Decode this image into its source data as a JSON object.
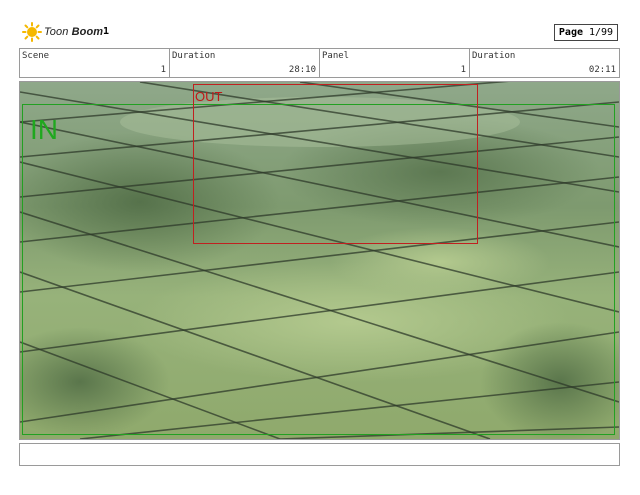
{
  "header": {
    "logo_text_a": "Toon",
    "logo_text_b": "Boom",
    "sheet_number": "1",
    "page_label": "Page",
    "page_value": "1/99"
  },
  "info": {
    "scene_label": "Scene",
    "scene_value": "1",
    "duration1_label": "Duration",
    "duration1_value": "28:10",
    "panel_label": "Panel",
    "panel_value": "1",
    "duration2_label": "Duration",
    "duration2_value": "02:11"
  },
  "panel": {
    "in_label": "IN",
    "out_label": "OUT",
    "in_color": "#22a022",
    "out_color": "#c02020",
    "scene": "aerial forest with grid overlay"
  },
  "caption": {
    "text": ""
  }
}
